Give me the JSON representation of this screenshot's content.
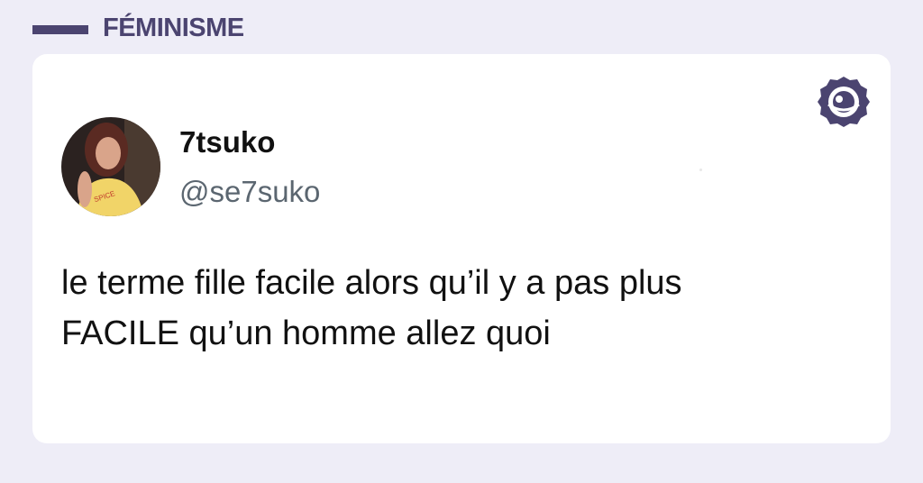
{
  "category": {
    "label": "FÉMINISME",
    "color": "#4b4470"
  },
  "tweet": {
    "display_name": "7tsuko",
    "handle": "@se7suko",
    "text": "le terme fille facile alors qu’il y a pas plus\nFACILE qu’un homme allez quoi",
    "avatar_shirt_text": "SPICE"
  },
  "colors": {
    "background": "#eeedf7",
    "card": "#ffffff",
    "accent": "#4b4470",
    "handle": "#5b6670"
  },
  "icons": {
    "brand": "brand-logo-icon"
  }
}
